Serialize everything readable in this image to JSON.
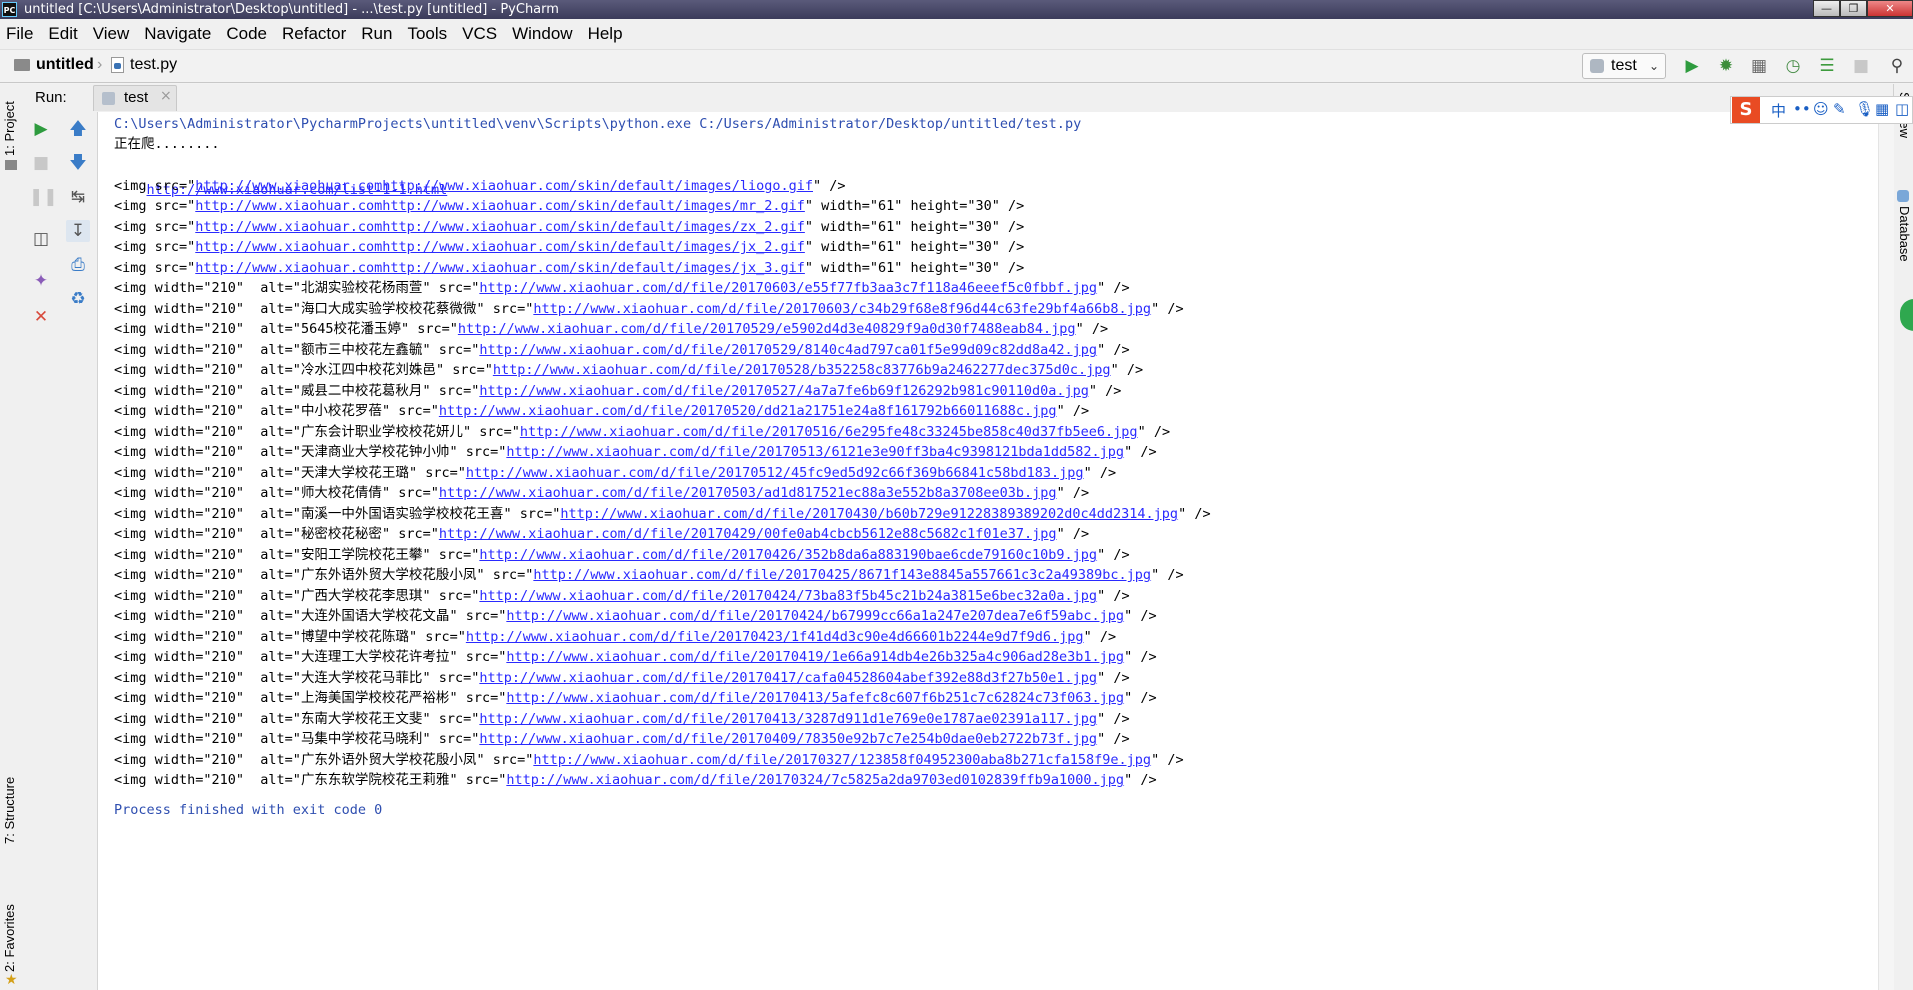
{
  "window": {
    "app_icon": "PC",
    "title": "untitled [C:\\Users\\Administrator\\Desktop\\untitled] - ...\\test.py [untitled] - PyCharm"
  },
  "menu": [
    "File",
    "Edit",
    "View",
    "Navigate",
    "Code",
    "Refactor",
    "Run",
    "Tools",
    "VCS",
    "Window",
    "Help"
  ],
  "navbar": {
    "project": "untitled",
    "file": "test.py",
    "run_config": "test"
  },
  "left_tool_windows": {
    "project": "1: Project",
    "structure": "7: Structure",
    "favorites": "2: Favorites"
  },
  "right_tool_windows": {
    "sciview": "SciView",
    "database": "Database"
  },
  "run_panel": {
    "label": "Run:",
    "tab": "test"
  },
  "ime_bar": {
    "logo": "S",
    "mode": "中"
  },
  "console": {
    "command": "C:\\Users\\Administrator\\PycharmProjects\\untitled\\venv\\Scripts\\python.exe C:/Users/Administrator/Desktop/untitled/test.py",
    "crawling": "正在爬........",
    "list_url": "http://www.xiaohuar.com/list-1-1.html",
    "header_imgs": [
      {
        "pre": "<img src=\"",
        "url": "http://www.xiaohuar.comhttp://www.xiaohuar.com/skin/default/images/liogo.gif",
        "post": "\" />"
      },
      {
        "pre": "<img src=\"",
        "url": "http://www.xiaohuar.comhttp://www.xiaohuar.com/skin/default/images/mr_2.gif",
        "post": "\" width=\"61\" height=\"30\" />"
      },
      {
        "pre": "<img src=\"",
        "url": "http://www.xiaohuar.comhttp://www.xiaohuar.com/skin/default/images/zx_2.gif",
        "post": "\" width=\"61\" height=\"30\" />"
      },
      {
        "pre": "<img src=\"",
        "url": "http://www.xiaohuar.comhttp://www.xiaohuar.com/skin/default/images/jx_2.gif",
        "post": "\" width=\"61\" height=\"30\" />"
      },
      {
        "pre": "<img src=\"",
        "url": "http://www.xiaohuar.comhttp://www.xiaohuar.com/skin/default/images/jx_3.gif",
        "post": "\" width=\"61\" height=\"30\" />"
      }
    ],
    "photo_imgs": [
      {
        "alt": "北湖实验校花杨雨萱",
        "url": "http://www.xiaohuar.com/d/file/20170603/e55f77fb3aa3c7f118a46eeef5c0fbbf.jpg"
      },
      {
        "alt": "海口大成实验学校校花蔡微微",
        "url": "http://www.xiaohuar.com/d/file/20170603/c34b29f68e8f96d44c63fe29bf4a66b8.jpg"
      },
      {
        "alt": "5645校花潘玉婷",
        "url": "http://www.xiaohuar.com/d/file/20170529/e5902d4d3e40829f9a0d30f7488eab84.jpg"
      },
      {
        "alt": "额市三中校花左鑫毓",
        "url": "http://www.xiaohuar.com/d/file/20170529/8140c4ad797ca01f5e99d09c82dd8a42.jpg"
      },
      {
        "alt": "冷水江四中校花刘姝邑",
        "url": "http://www.xiaohuar.com/d/file/20170528/b352258c83776b9a2462277dec375d0c.jpg"
      },
      {
        "alt": "威县二中校花葛秋月",
        "url": "http://www.xiaohuar.com/d/file/20170527/4a7a7fe6b69f126292b981c90110d0a.jpg"
      },
      {
        "alt": "中小校花罗蓓",
        "url": "http://www.xiaohuar.com/d/file/20170520/dd21a21751e24a8f161792b66011688c.jpg"
      },
      {
        "alt": "广东会计职业学校校花妍儿",
        "url": "http://www.xiaohuar.com/d/file/20170516/6e295fe48c33245be858c40d37fb5ee6.jpg"
      },
      {
        "alt": "天津商业大学校花钟小帅",
        "url": "http://www.xiaohuar.com/d/file/20170513/6121e3e90ff3ba4c9398121bda1dd582.jpg"
      },
      {
        "alt": "天津大学校花王璐",
        "url": "http://www.xiaohuar.com/d/file/20170512/45fc9ed5d92c66f369b66841c58bd183.jpg"
      },
      {
        "alt": "师大校花倩倩",
        "url": "http://www.xiaohuar.com/d/file/20170503/ad1d817521ec88a3e552b8a3708ee03b.jpg"
      },
      {
        "alt": "南溪一中外国语实验学校校花王喜",
        "url": "http://www.xiaohuar.com/d/file/20170430/b60b729e91228389389202d0c4dd2314.jpg"
      },
      {
        "alt": "秘密校花秘密",
        "url": "http://www.xiaohuar.com/d/file/20170429/00fe0ab4cbcb5612e88c5682c1f01e37.jpg"
      },
      {
        "alt": "安阳工学院校花王攀",
        "url": "http://www.xiaohuar.com/d/file/20170426/352b8da6a883190bae6cde79160c10b9.jpg"
      },
      {
        "alt": "广东外语外贸大学校花殷小凤",
        "url": "http://www.xiaohuar.com/d/file/20170425/8671f143e8845a557661c3c2a49389bc.jpg"
      },
      {
        "alt": "广西大学校花李思琪",
        "url": "http://www.xiaohuar.com/d/file/20170424/73ba83f5b45c21b24a3815e6bec32a0a.jpg"
      },
      {
        "alt": "大连外国语大学校花文晶",
        "url": "http://www.xiaohuar.com/d/file/20170424/b67999cc66a1a247e207dea7e6f59abc.jpg"
      },
      {
        "alt": "博望中学校花陈璐",
        "url": "http://www.xiaohuar.com/d/file/20170423/1f41d4d3c90e4d66601b2244e9d7f9d6.jpg"
      },
      {
        "alt": "大连理工大学校花许考拉",
        "url": "http://www.xiaohuar.com/d/file/20170419/1e66a914db4e26b325a4c906ad28e3b1.jpg"
      },
      {
        "alt": "大连大学校花马菲比",
        "url": "http://www.xiaohuar.com/d/file/20170417/cafa04528604abef392e88d3f27b50e1.jpg"
      },
      {
        "alt": "上海美国学校校花严裕彬",
        "url": "http://www.xiaohuar.com/d/file/20170413/5afefc8c607f6b251c7c62824c73f063.jpg"
      },
      {
        "alt": "东南大学校花王文斐",
        "url": "http://www.xiaohuar.com/d/file/20170413/3287d911d1e769e0e1787ae02391a117.jpg"
      },
      {
        "alt": "马集中学校花马晓利",
        "url": "http://www.xiaohuar.com/d/file/20170409/78350e92b7c7e254b0dae0eb2722b73f.jpg"
      },
      {
        "alt": "广东外语外贸大学校花殷小凤",
        "url": "http://www.xiaohuar.com/d/file/20170327/123858f04952300aba8b271cfa158f9e.jpg"
      },
      {
        "alt": "广东东软学院校花王莉雅",
        "url": "http://www.xiaohuar.com/d/file/20170324/7c5825a2da9703ed0102839ffb9a1000.jpg"
      }
    ],
    "photo_pre": "<img width=\"210\"  alt=\"",
    "photo_mid": "\" src=\"",
    "photo_post": "\" />",
    "exit": "Process finished with exit code 0"
  }
}
